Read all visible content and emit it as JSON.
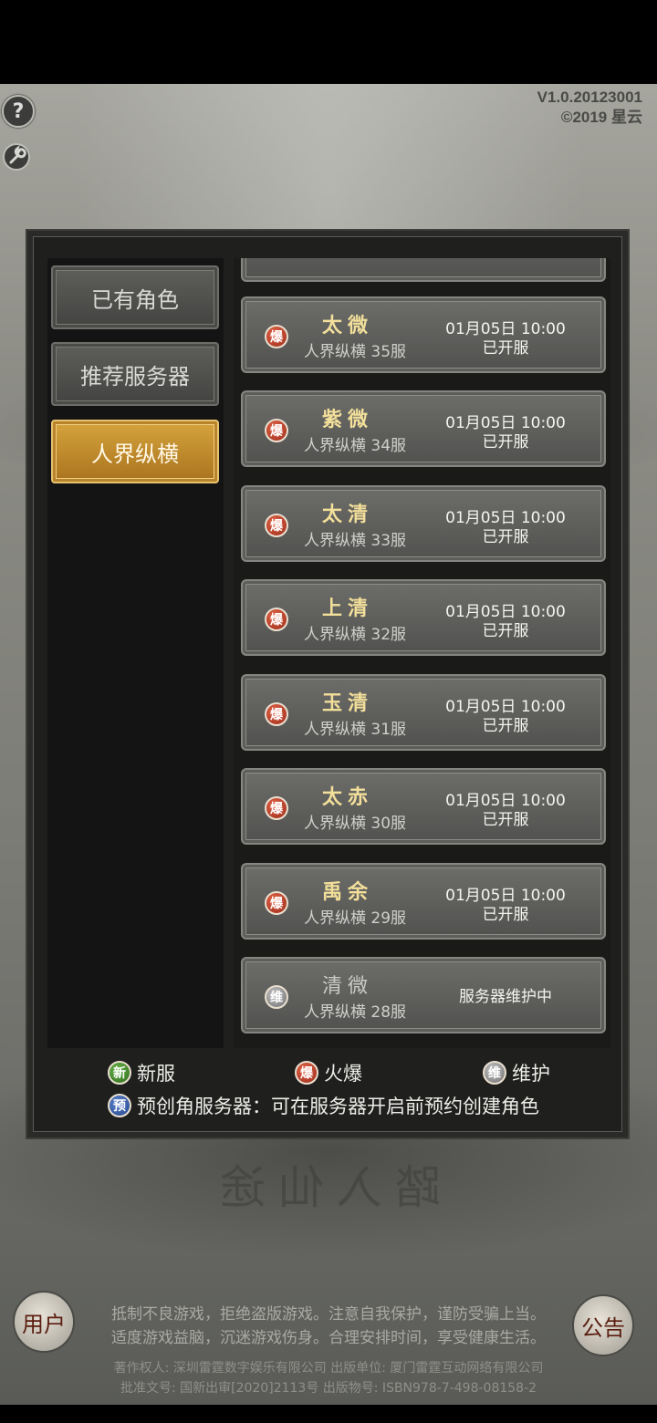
{
  "version": {
    "build": "V1.0.20123001",
    "copyright": "©2019 星云"
  },
  "tabs": [
    {
      "label": "已有角色",
      "active": false
    },
    {
      "label": "推荐服务器",
      "active": false
    },
    {
      "label": "人界纵横",
      "active": true
    }
  ],
  "servers": [
    {
      "badge": "爆",
      "status": "hot",
      "name": "太微",
      "subtitle": "人界纵横 35服",
      "time": "01月05日 10:00",
      "state": "已开服"
    },
    {
      "badge": "爆",
      "status": "hot",
      "name": "紫微",
      "subtitle": "人界纵横 34服",
      "time": "01月05日 10:00",
      "state": "已开服"
    },
    {
      "badge": "爆",
      "status": "hot",
      "name": "太清",
      "subtitle": "人界纵横 33服",
      "time": "01月05日 10:00",
      "state": "已开服"
    },
    {
      "badge": "爆",
      "status": "hot",
      "name": "上清",
      "subtitle": "人界纵横 32服",
      "time": "01月05日 10:00",
      "state": "已开服"
    },
    {
      "badge": "爆",
      "status": "hot",
      "name": "玉清",
      "subtitle": "人界纵横 31服",
      "time": "01月05日 10:00",
      "state": "已开服"
    },
    {
      "badge": "爆",
      "status": "hot",
      "name": "太赤",
      "subtitle": "人界纵横 30服",
      "time": "01月05日 10:00",
      "state": "已开服"
    },
    {
      "badge": "爆",
      "status": "hot",
      "name": "禹余",
      "subtitle": "人界纵横 29服",
      "time": "01月05日 10:00",
      "state": "已开服"
    },
    {
      "badge": "维",
      "status": "maint",
      "name": "清微",
      "subtitle": "人界纵横 28服",
      "time": "",
      "state": "服务器维护中"
    }
  ],
  "legend": {
    "new": {
      "badge": "新",
      "label": "新服"
    },
    "hot": {
      "badge": "爆",
      "label": "火爆"
    },
    "maint": {
      "badge": "维",
      "label": "维护"
    },
    "pre": {
      "badge": "预",
      "label": "预创角服务器：可在服务器开启前预约创建角色"
    }
  },
  "background_title": "踏入仙途",
  "buttons": {
    "user": "用户",
    "notice": "公告",
    "help": "?",
    "settings_icon": "wrench-icon"
  },
  "health_notice": [
    "抵制不良游戏，拒绝盗版游戏。注意自我保护，谨防受骗上当。",
    "适度游戏益脑，沉迷游戏伤身。合理安排时间，享受健康生活。"
  ],
  "copyright_lines": [
    "著作权人: 深圳雷霆数字娱乐有限公司 出版单位: 厦门雷霆互动网络有限公司",
    "批准文号: 国新出审[2020]2113号 出版物号: ISBN978-7-498-08158-2"
  ],
  "colors": {
    "accent_gold": "#d6a43e",
    "server_name": "#f2df9a",
    "hot_badge": "#c4432a"
  }
}
